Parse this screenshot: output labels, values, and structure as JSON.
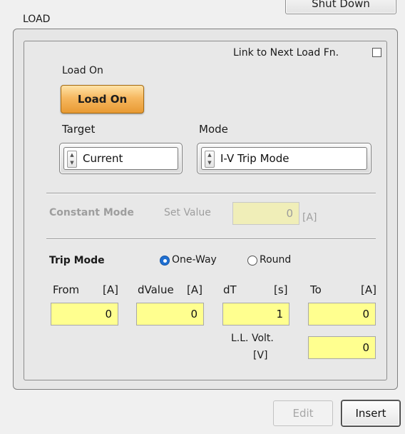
{
  "top_button": {
    "label": "Shut Down"
  },
  "section": {
    "title": "LOAD"
  },
  "link_next": {
    "label": "Link to Next Load Fn.",
    "checked": false
  },
  "load_on": {
    "caption": "Load On",
    "button_label": "Load On",
    "active": true
  },
  "target": {
    "label": "Target",
    "value": "Current"
  },
  "mode": {
    "label": "Mode",
    "value": "I-V Trip Mode"
  },
  "constant_mode": {
    "label": "Constant Mode",
    "set_value_label": "Set Value",
    "value": "0",
    "unit": "[A]"
  },
  "trip_mode": {
    "label": "Trip Mode",
    "options": [
      {
        "label": "One-Way",
        "selected": true
      },
      {
        "label": "Round",
        "selected": false
      }
    ],
    "fields": {
      "from": {
        "name": "From",
        "unit": "[A]",
        "value": "0"
      },
      "dvalue": {
        "name": "dValue",
        "unit": "[A]",
        "value": "0"
      },
      "dt": {
        "name": "dT",
        "unit": "[s]",
        "value": "1"
      },
      "to": {
        "name": "To",
        "unit": "[A]",
        "value": "0"
      }
    },
    "ll_volt": {
      "label": "L.L. Volt.",
      "unit": "[V]",
      "value": "0"
    }
  },
  "actions": {
    "edit": "Edit",
    "insert": "Insert"
  },
  "colors": {
    "field_yellow": "#ffff8f",
    "load_on_orange": "#f6b860",
    "radio_blue": "#1f6fd1"
  }
}
